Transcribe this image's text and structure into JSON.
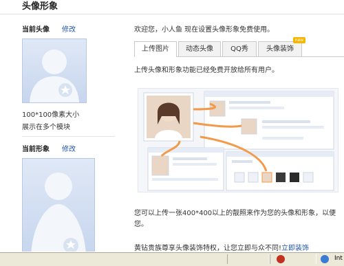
{
  "page_title": "头像形象",
  "left": {
    "current_avatar_label": "当前头像",
    "current_avatar_edit": "修改",
    "size_note": "100*100像素大小",
    "display_note": "展示在多个模块",
    "current_image_label": "当前形象",
    "current_image_edit": "修改"
  },
  "right": {
    "welcome": "欢迎您，小人鱼 现在设置头像形象免费使用。",
    "tabs": [
      {
        "label": "上传图片",
        "active": true
      },
      {
        "label": "动态头像",
        "active": false
      },
      {
        "label": "QQ秀",
        "active": false
      },
      {
        "label": "头像装饰",
        "active": false,
        "badge": "new"
      }
    ],
    "intro": "上传头像和形象功能已经免费开放给所有用户。",
    "para_1": "您可以上传一张400*400以上的靓照来作为您的头像和形象，以便",
    "para_2": "您。",
    "vip_text": "黄钻贵族尊享头像装饰特权，让您立即与众不同!",
    "vip_link": "立即装饰"
  },
  "status_bar": {
    "zone_text": "Int"
  },
  "colors": {
    "link": "#2255aa",
    "avatar_bg": "#c7d6ee",
    "badge": "#f7b500",
    "arrow": "#f39a4a"
  }
}
